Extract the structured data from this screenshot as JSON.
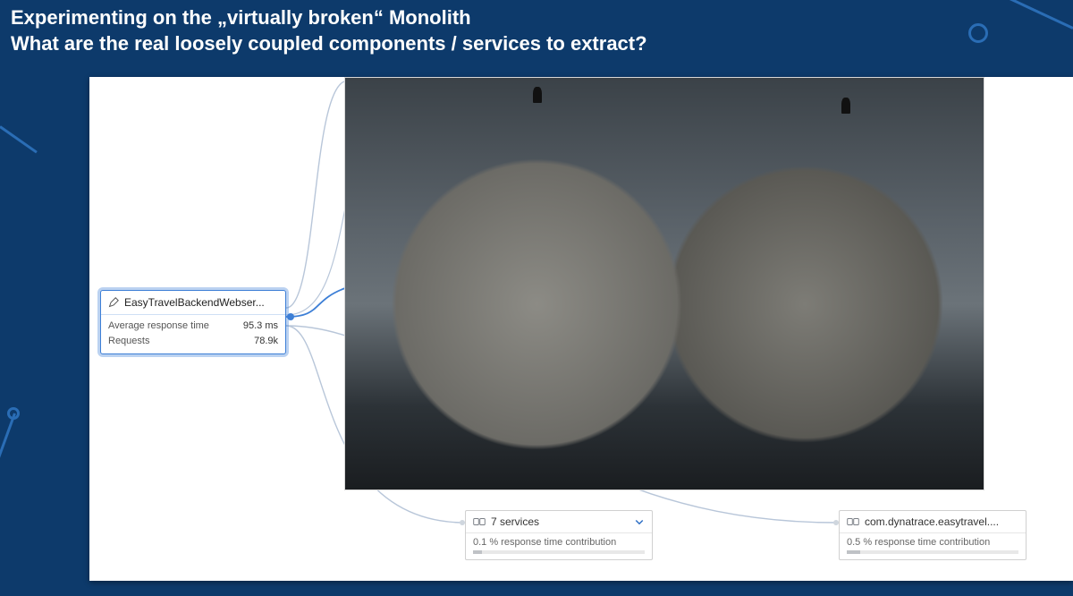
{
  "title_line1": "Experimenting on the „virtually broken“ Monolith",
  "title_line2": "What are the real loosely coupled components / services to extract?",
  "source_node": {
    "name": "EasyTravelBackendWebser...",
    "metrics": {
      "avg_label": "Average response time",
      "avg_value": "95.3 ms",
      "req_label": "Requests",
      "req_value": "78.9k"
    }
  },
  "downstream": [
    {
      "id": "group7",
      "label": "7 services",
      "expandable": true,
      "contrib_label": "0.1 % response time contribution",
      "contrib_pct": 0.1
    },
    {
      "id": "easytravel",
      "label": "com.dynatrace.easytravel....",
      "expandable": false,
      "contrib_label": "0.5 % response time contribution",
      "contrib_pct": 0.5
    }
  ]
}
